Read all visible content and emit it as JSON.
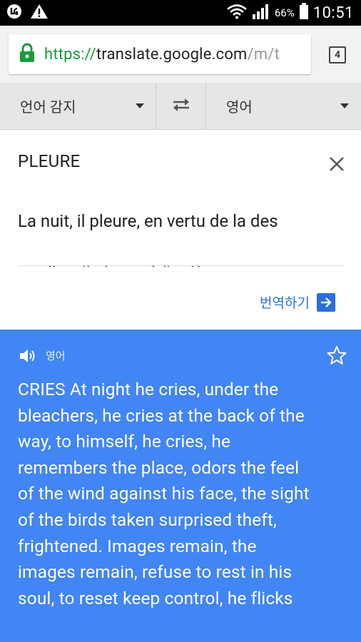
{
  "status_bar": {
    "battery_percent": "66%",
    "time": "10:51",
    "icons": [
      "lg-icon",
      "warning-icon",
      "wifi-icon",
      "signal-icon",
      "battery-icon"
    ]
  },
  "browser": {
    "url_scheme": "https://",
    "url_host": "translate.google.com",
    "url_path": "/m/t",
    "tab_count": "4"
  },
  "languages": {
    "source": "언어 감지",
    "target": "영어"
  },
  "input": {
    "title": "PLEURE",
    "text": "La nuit, il pleure, en vertu de la des gradins, il pleure, à l'arrière",
    "translate_label": "번역하기"
  },
  "result": {
    "language_label": "영어",
    "text": "CRIES At night he cries, under the bleachers, he cries at the back of the way, to himself, he cries, he remembers the place, odors the feel of the wind against his face, the sight of the birds taken surprised theft, frightened. Images remain, the images remain, refuse to rest in his soul, to reset keep control, he flicks "
  },
  "colors": {
    "accent_blue": "#4285f4",
    "link_blue": "#2a6fdb",
    "secure_green": "#1a9b3e"
  }
}
